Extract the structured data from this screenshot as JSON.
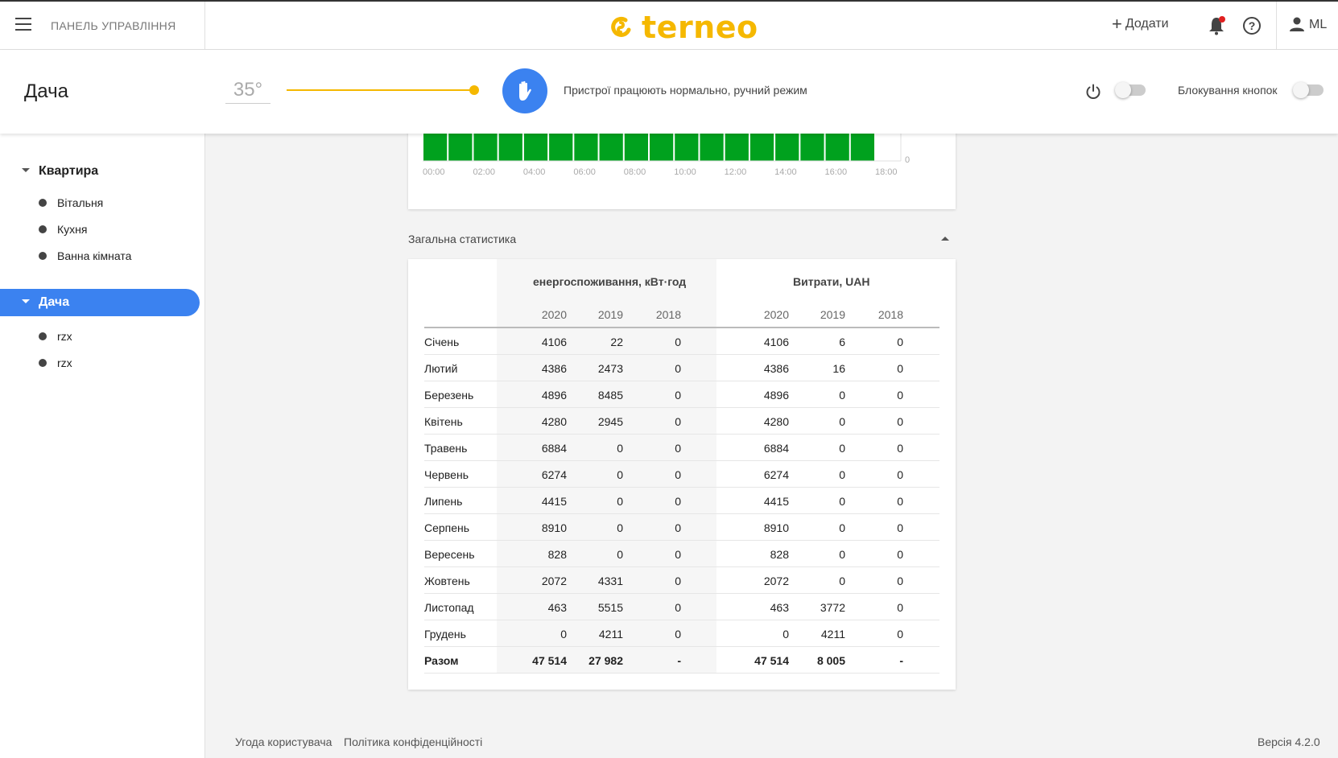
{
  "header": {
    "panel_title": "ПАНЕЛЬ УПРАВЛІННЯ",
    "logo_text": "terneo",
    "add_label": "Додати",
    "user_initials": "ML",
    "brand_color": "#f5b800",
    "accent_color": "#3b82f0",
    "notification_dot_color": "#e02020"
  },
  "device": {
    "title": "Дача",
    "temperature": "35°",
    "status": "Пристрої працюють нормально, ручний режим",
    "power_on": false,
    "lock_label": "Блокування кнопок",
    "lock_on": false
  },
  "sidebar": {
    "groups": [
      {
        "label": "Квартира",
        "expanded": true,
        "active": false,
        "items": [
          "Вітальня",
          "Кухня",
          "Ванна кімната"
        ]
      },
      {
        "label": "Дача",
        "expanded": true,
        "active": true,
        "items": [
          "rzx",
          "rzx"
        ]
      }
    ]
  },
  "chart_data": {
    "type": "bar",
    "x_tick_labels": [
      "00:00",
      "02:00",
      "04:00",
      "06:00",
      "08:00",
      "10:00",
      "12:00",
      "14:00",
      "16:00",
      "18:00"
    ],
    "y_tick_labels": [
      "0"
    ],
    "bar_count": 18,
    "bar_color": "#00a11e"
  },
  "stats": {
    "section_title": "Загальна статистика",
    "group_energy": "енергоспоживання, кВт·год",
    "group_cost": "Витрати, UAH",
    "years": [
      "2020",
      "2019",
      "2018"
    ],
    "rows": [
      {
        "month": "Січень",
        "e": [
          "4106",
          "22",
          "0"
        ],
        "c": [
          "4106",
          "6",
          "0"
        ]
      },
      {
        "month": "Лютий",
        "e": [
          "4386",
          "2473",
          "0"
        ],
        "c": [
          "4386",
          "16",
          "0"
        ]
      },
      {
        "month": "Березень",
        "e": [
          "4896",
          "8485",
          "0"
        ],
        "c": [
          "4896",
          "0",
          "0"
        ]
      },
      {
        "month": "Квітень",
        "e": [
          "4280",
          "2945",
          "0"
        ],
        "c": [
          "4280",
          "0",
          "0"
        ]
      },
      {
        "month": "Травень",
        "e": [
          "6884",
          "0",
          "0"
        ],
        "c": [
          "6884",
          "0",
          "0"
        ]
      },
      {
        "month": "Червень",
        "e": [
          "6274",
          "0",
          "0"
        ],
        "c": [
          "6274",
          "0",
          "0"
        ]
      },
      {
        "month": "Липень",
        "e": [
          "4415",
          "0",
          "0"
        ],
        "c": [
          "4415",
          "0",
          "0"
        ]
      },
      {
        "month": "Серпень",
        "e": [
          "8910",
          "0",
          "0"
        ],
        "c": [
          "8910",
          "0",
          "0"
        ]
      },
      {
        "month": "Вересень",
        "e": [
          "828",
          "0",
          "0"
        ],
        "c": [
          "828",
          "0",
          "0"
        ]
      },
      {
        "month": "Жовтень",
        "e": [
          "2072",
          "4331",
          "0"
        ],
        "c": [
          "2072",
          "0",
          "0"
        ]
      },
      {
        "month": "Листопад",
        "e": [
          "463",
          "5515",
          "0"
        ],
        "c": [
          "463",
          "3772",
          "0"
        ]
      },
      {
        "month": "Грудень",
        "e": [
          "0",
          "4211",
          "0"
        ],
        "c": [
          "0",
          "4211",
          "0"
        ]
      }
    ],
    "total": {
      "label": "Разом",
      "e": [
        "47 514",
        "27 982",
        "-"
      ],
      "c": [
        "47 514",
        "8 005",
        "-"
      ]
    }
  },
  "footer": {
    "terms": "Угода користувача",
    "privacy": "Політика конфіденційності",
    "version": "Версія 4.2.0"
  }
}
